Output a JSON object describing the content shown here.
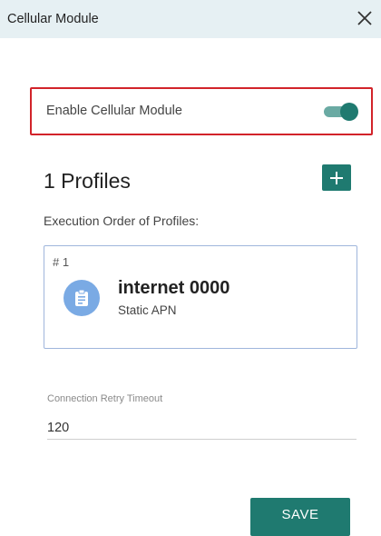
{
  "header": {
    "title": "Cellular Module",
    "close_symbol": "✕",
    "close_icon": "close-icon"
  },
  "enable": {
    "label": "Enable Cellular Module",
    "enabled": true,
    "toggle_color": "#1f7a70"
  },
  "profiles": {
    "title": "1 Profiles",
    "add_icon": "plus-icon",
    "execution_label": "Execution Order of Profiles:",
    "items": [
      {
        "index": "# 1",
        "name": "internet 0000",
        "type": "Static APN",
        "icon": "clipboard-icon",
        "icon_color": "#7aaae4"
      }
    ]
  },
  "retry": {
    "label": "Connection Retry Timeout",
    "value": "120"
  },
  "actions": {
    "save_label": "SAVE"
  },
  "colors": {
    "accent": "#1f7a70",
    "highlight_border": "#d2232a",
    "header_bg": "#e6f0f3"
  }
}
